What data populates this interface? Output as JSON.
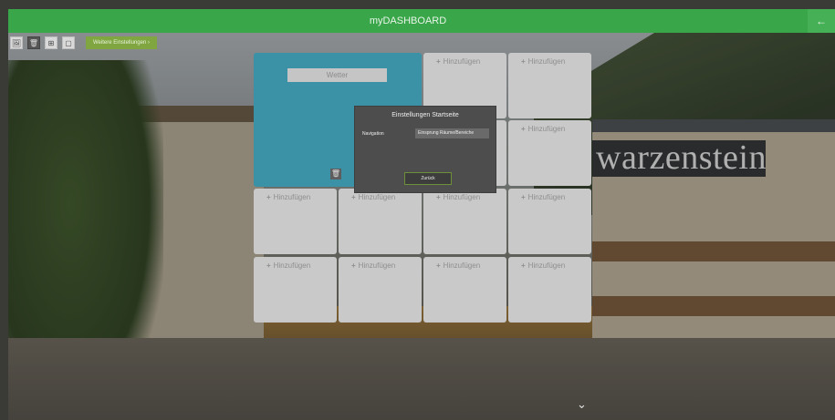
{
  "header": {
    "title": "myDASHBOARD",
    "back_icon": "←"
  },
  "toolbar": {
    "icons": {
      "image": "🖼",
      "trash": "🗑",
      "grid": "⊞",
      "square": "▢"
    },
    "more_label": "Weitere Einstellungen ›"
  },
  "weather": {
    "label": "Wetter",
    "trash_icon": "🗑"
  },
  "tiles": {
    "add_label": "Hinzufügen",
    "plus": "+"
  },
  "modal": {
    "title": "Einstellungen Startseite",
    "nav_label": "Navigation",
    "nav_value": "Einsprung Räume/Bereiche",
    "back_label": "Zurück"
  },
  "background": {
    "sign_text": "warzenstein"
  },
  "scroll": {
    "chevron": "⌄"
  },
  "colors": {
    "header": "#3aa64a",
    "weather_tile": "#3b91a5",
    "tile": "#c9c9c9",
    "modal": "#4d4d4d"
  }
}
